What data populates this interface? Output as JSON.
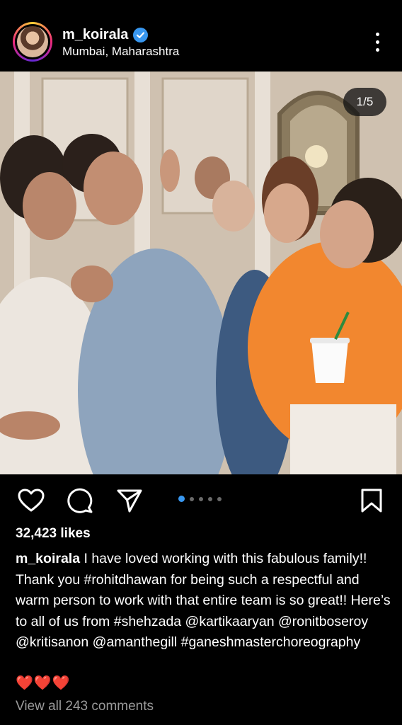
{
  "post": {
    "username": "m_koirala",
    "verified": true,
    "location": "Mumbai, Maharashtra",
    "media_counter": "1/5",
    "carousel_total": 5,
    "carousel_active_index": 0
  },
  "icons": {
    "like": "heart-icon",
    "comment": "comment-icon",
    "share": "send-icon",
    "save": "bookmark-icon",
    "more": "more-vertical-icon",
    "verified": "verified-badge-icon"
  },
  "engagement": {
    "likes": "32,423 likes"
  },
  "caption": {
    "username": "m_koirala",
    "text": " I have loved working with this fabulous family!! Thank you #rohitdhawan for being such a respectful and warm person to work with that entire team is so great!! Here’s to all of us from #shehzada @kartikaaryan @ronitboseroy @kritisanon @amanthegill #ganeshmasterchoreography",
    "emoji": "❤️❤️❤️"
  },
  "comments": {
    "view_all": "View all 243 comments"
  },
  "colors": {
    "background": "#000000",
    "accent": "#3897f0",
    "secondary_text": "#9a9a9a",
    "heart_red": "#e0245e"
  }
}
